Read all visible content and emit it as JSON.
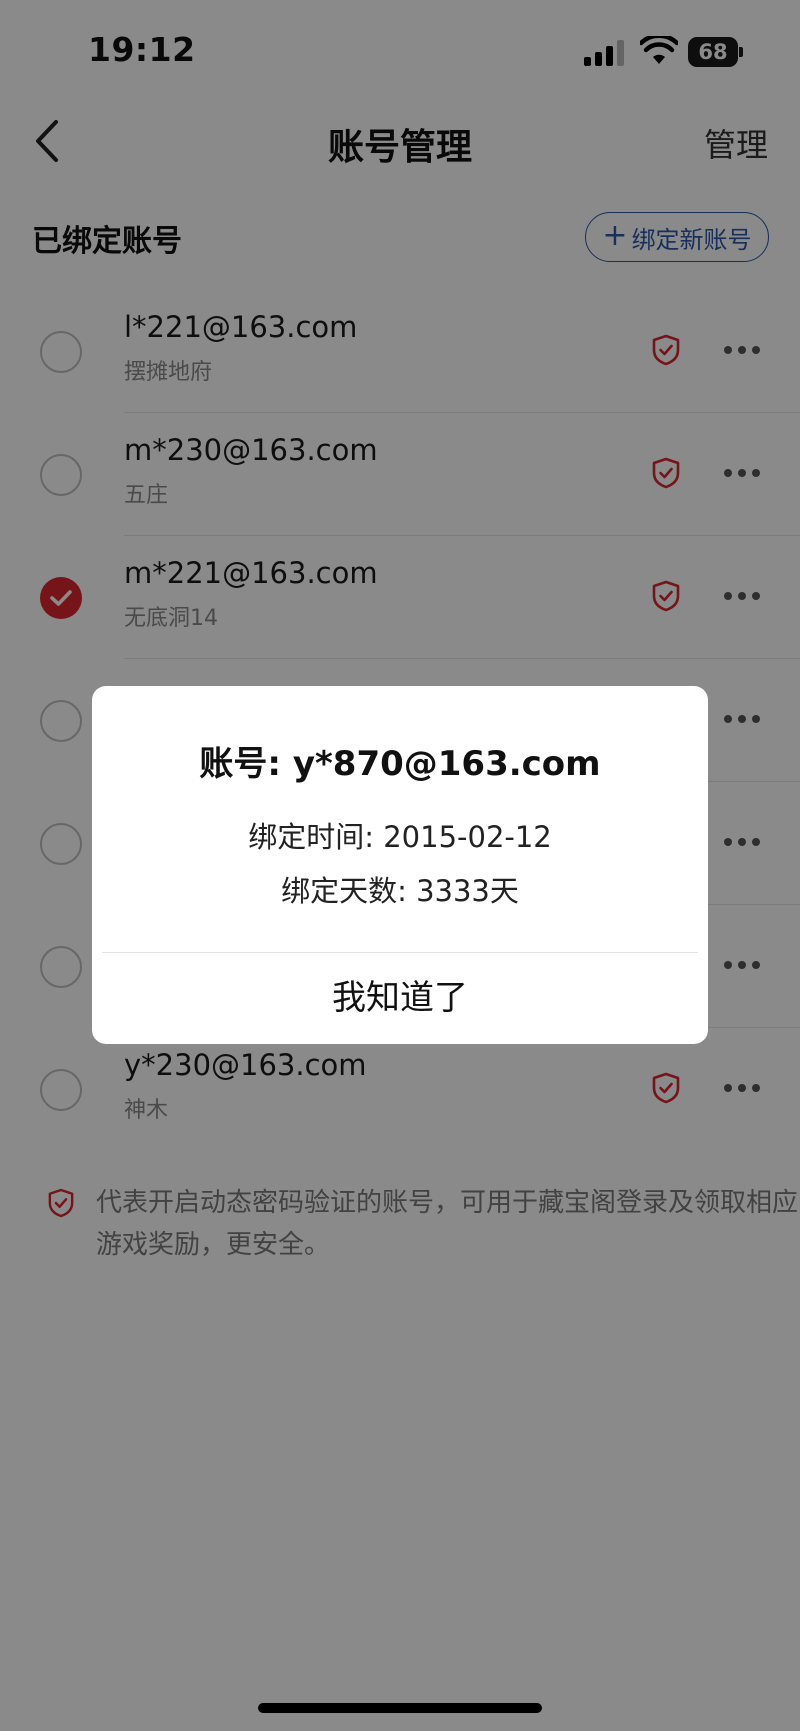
{
  "status_bar": {
    "time": "19:12",
    "battery": "68"
  },
  "nav": {
    "title": "账号管理",
    "manage": "管理"
  },
  "section": {
    "title": "已绑定账号",
    "bind_button": "绑定新账号",
    "bind_plus": "+"
  },
  "accounts": [
    {
      "email": "l*221@163.com",
      "server": "摆摊地府",
      "selected": false
    },
    {
      "email": "m*230@163.com",
      "server": "五庄",
      "selected": false
    },
    {
      "email": "m*221@163.com",
      "server": "无底洞14",
      "selected": true
    },
    {
      "email": "",
      "server": "",
      "selected": false
    },
    {
      "email": "",
      "server": "",
      "selected": false
    },
    {
      "email": "",
      "server": "",
      "selected": false
    },
    {
      "email": "y*230@163.com",
      "server": "神木",
      "selected": false
    }
  ],
  "note": {
    "text": "代表开启动态密码验证的账号，可用于藏宝阁登录及领取相应游戏奖励，更安全。"
  },
  "dialog": {
    "title": "账号: y*870@163.com",
    "bind_time": "绑定时间: 2015-02-12",
    "bind_days": "绑定天数: 3333天",
    "ok_button": "我知道了"
  },
  "colors": {
    "accent_red": "#d8262f",
    "link_blue": "#2e5aa8",
    "overlay": "rgba(0,0,0,0.46)"
  }
}
